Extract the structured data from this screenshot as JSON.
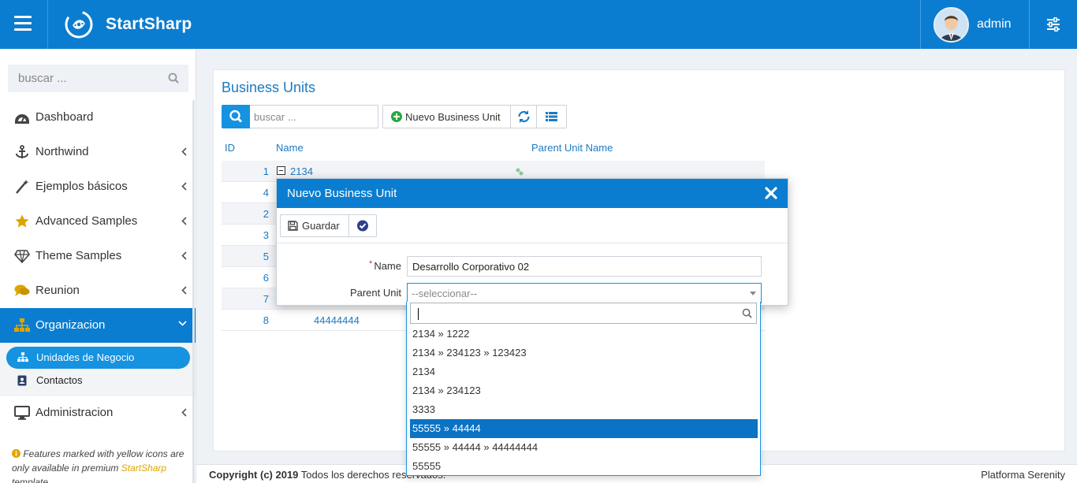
{
  "header": {
    "brand": "StartSharp",
    "user": "admin"
  },
  "sidebar": {
    "search_placeholder": "buscar ...",
    "items": [
      {
        "label": "Dashboard",
        "icon": "dashboard-icon"
      },
      {
        "label": "Northwind",
        "icon": "anchor-icon"
      },
      {
        "label": "Ejemplos básicos",
        "icon": "magic-wand-icon"
      },
      {
        "label": "Advanced Samples",
        "icon": "star-icon"
      },
      {
        "label": "Theme Samples",
        "icon": "diamond-icon"
      },
      {
        "label": "Reunion",
        "icon": "comments-icon"
      },
      {
        "label": "Organizacion",
        "icon": "sitemap-icon"
      },
      {
        "label": "Administracion",
        "icon": "desktop-icon"
      }
    ],
    "subitems": [
      {
        "label": "Unidades de Negocio",
        "icon": "sitemap-icon"
      },
      {
        "label": "Contactos",
        "icon": "contact-book-icon"
      }
    ],
    "note_pre": "Features marked with yellow icons are only available in premium ",
    "note_link": "StartSharp",
    "note_post": " template"
  },
  "page": {
    "title": "Business Units",
    "search_placeholder": "buscar ...",
    "new_button": "Nuevo Business Unit",
    "columns": {
      "id": "ID",
      "name": "Name",
      "parent": "Parent Unit Name"
    },
    "rows": [
      {
        "id": "1",
        "name": "2134"
      },
      {
        "id": "4",
        "name": ""
      },
      {
        "id": "2",
        "name": ""
      },
      {
        "id": "3",
        "name": ""
      },
      {
        "id": "5",
        "name": ""
      },
      {
        "id": "6",
        "name": ""
      },
      {
        "id": "7",
        "name": ""
      },
      {
        "id": "8",
        "name": "44444444"
      }
    ]
  },
  "dialog": {
    "title": "Nuevo Business Unit",
    "save_label": "Guardar",
    "name_label": "Name",
    "name_value": "Desarrollo Corporativo 02",
    "parent_label": "Parent Unit",
    "parent_placeholder": "--seleccionar--",
    "options": [
      "2134 » 1222",
      "2134 » 234123 » 123423",
      "2134",
      "2134 » 234123",
      "3333",
      "55555 » 44444",
      "55555 » 44444 » 44444444",
      "55555"
    ],
    "highlighted_option": "55555 » 44444"
  },
  "footer": {
    "copyright_bold": "Copyright (c) 2019",
    "copyright_rest": " Todos los derechos reservados.",
    "platform": "Platforma Serenity"
  },
  "colors": {
    "primary": "#0b7dd0",
    "accent": "#1592e0",
    "premium": "#e0a400"
  }
}
